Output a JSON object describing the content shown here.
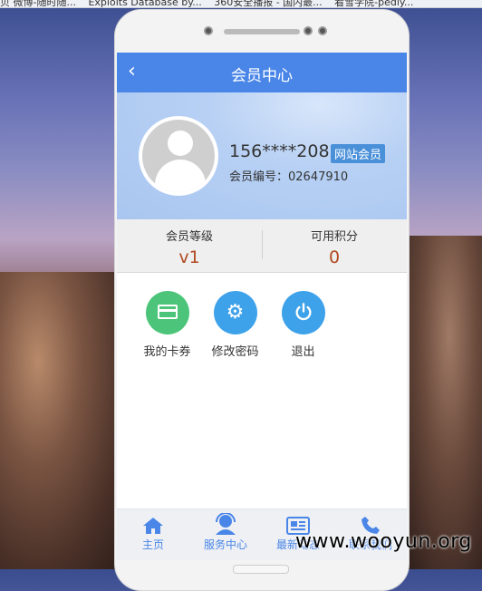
{
  "browser": {
    "bookmarks": [
      "贝 微博-随时随...",
      "Exploits Database by...",
      "360安全播报 - 国内最...",
      "看雪学院-pediy..."
    ]
  },
  "header": {
    "title": "会员中心"
  },
  "profile": {
    "phone": "156****2085",
    "badge": "网站会员",
    "member_id": "会员编号：02647910"
  },
  "stats": [
    {
      "label": "会员等级",
      "value": "v1"
    },
    {
      "label": "可用积分",
      "value": "0"
    }
  ],
  "actions": [
    {
      "label": "我的卡券",
      "icon": "card-icon",
      "color": "#4cc57a"
    },
    {
      "label": "修改密码",
      "icon": "gear-icon",
      "color": "#3ea2ea"
    },
    {
      "label": "退出",
      "icon": "power-icon",
      "color": "#3ea2ea"
    }
  ],
  "nav": [
    {
      "label": "主页",
      "icon": "home-icon"
    },
    {
      "label": "服务中心",
      "icon": "service-icon"
    },
    {
      "label": "最新动态",
      "icon": "news-icon"
    },
    {
      "label": "联系我们",
      "icon": "phone-icon"
    }
  ],
  "watermark": "www.wooyun.org",
  "colors": {
    "accent": "#4a86e8",
    "value": "#b04a1f",
    "badge": "#4a90d9"
  }
}
